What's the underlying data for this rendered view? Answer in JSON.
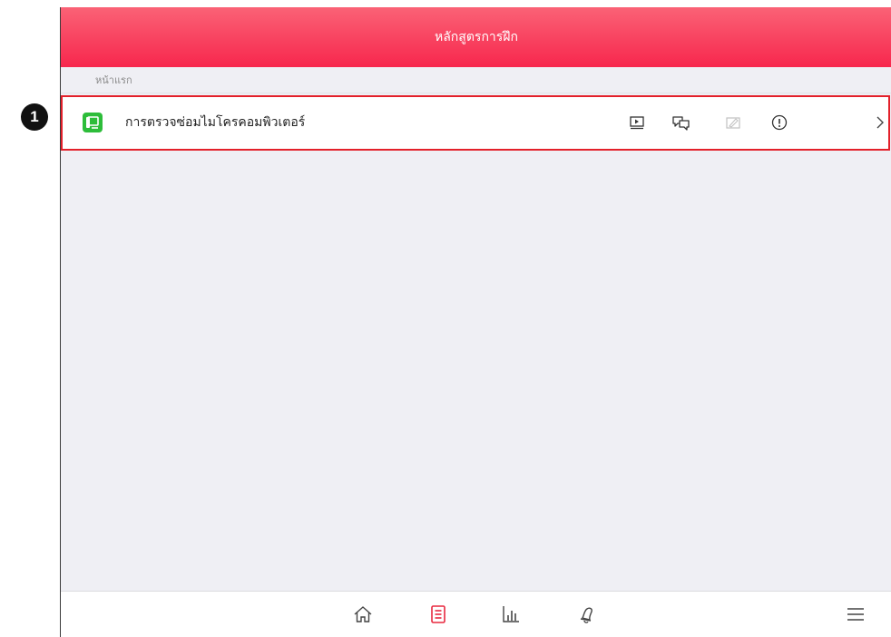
{
  "callout": {
    "number": "1"
  },
  "header": {
    "title": "หลักสูตรการฝึก",
    "color_top": "#fa6276",
    "color_bottom": "#f7274d"
  },
  "breadcrumb": {
    "label": "หน้าแรก"
  },
  "course": {
    "title": "การตรวจซ่อมไมโครคอมพิวเตอร์",
    "icon": "course-book-icon",
    "icon_color": "#2dbd3a",
    "highlight_color": "#e3202a",
    "actions": [
      {
        "name": "video-icon",
        "enabled": true
      },
      {
        "name": "chat-icon",
        "enabled": true
      },
      {
        "name": "edit-icon",
        "enabled": false
      },
      {
        "name": "info-icon",
        "enabled": true
      }
    ]
  },
  "bottom_nav": {
    "active_color": "#e8283f",
    "items": [
      {
        "name": "home-icon",
        "active": false
      },
      {
        "name": "courses-icon",
        "active": true
      },
      {
        "name": "stats-icon",
        "active": false
      },
      {
        "name": "notifications-icon",
        "active": false
      },
      {
        "name": "menu-icon",
        "active": false
      }
    ]
  }
}
